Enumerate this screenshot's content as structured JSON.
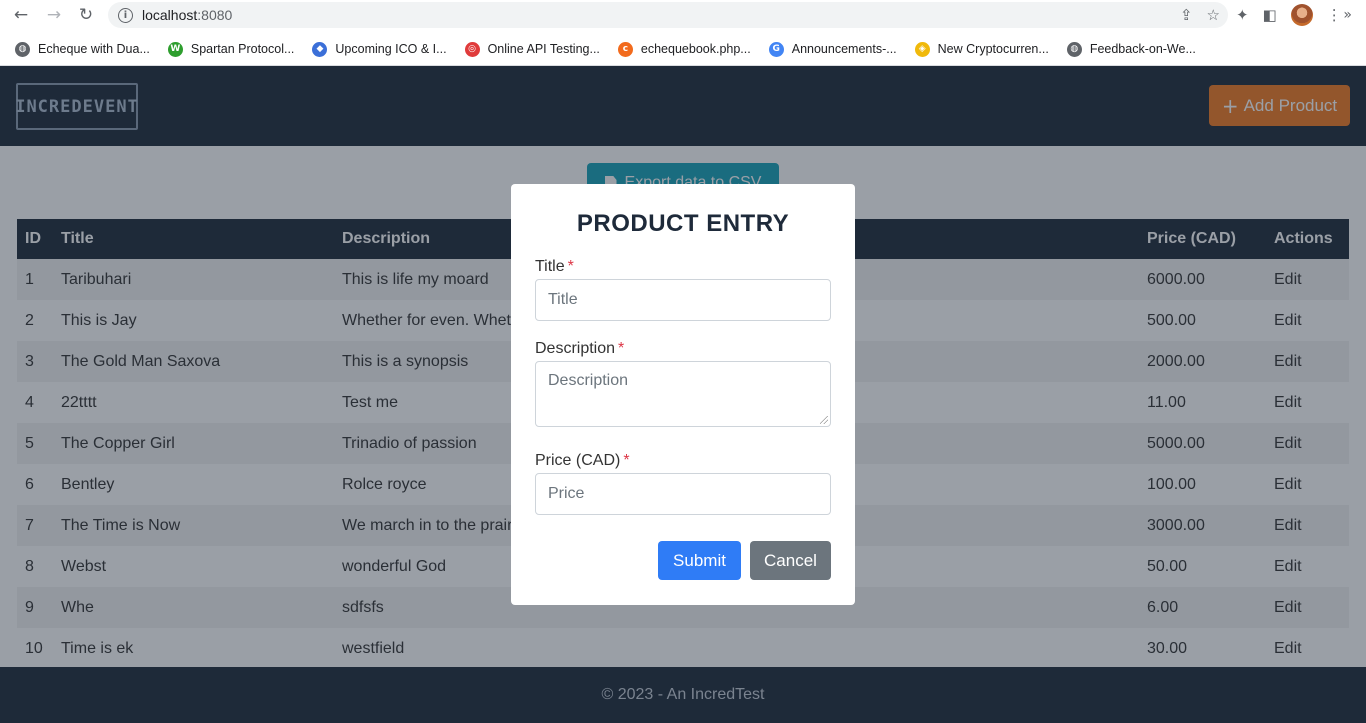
{
  "browser": {
    "url_host": "localhost",
    "url_port": ":8080",
    "bookmarks": [
      {
        "label": "Echeque with Dua...",
        "icon": "globe-icon",
        "color": "#5f6368"
      },
      {
        "label": "Spartan Protocol...",
        "icon": "spartan-icon",
        "color": "#2e9e2e"
      },
      {
        "label": "Upcoming ICO & I...",
        "icon": "drop-icon",
        "color": "#3b6fd8"
      },
      {
        "label": "Online API Testing...",
        "icon": "api-icon",
        "color": "#e03b3b"
      },
      {
        "label": "echequebook.php...",
        "icon": "cpanel-icon",
        "color": "#f26b1d"
      },
      {
        "label": "Announcements-...",
        "icon": "g-icon",
        "color": "#4285f4"
      },
      {
        "label": "New Cryptocurren...",
        "icon": "binance-icon",
        "color": "#f0b90b"
      },
      {
        "label": "Feedback-on-We...",
        "icon": "globe-icon",
        "color": "#5f6368"
      }
    ]
  },
  "app": {
    "logo_text": "INCREDEVENT",
    "add_button_label": "Add Product",
    "export_button_label": "Export data to CSV",
    "footer_text": "© 2023 - An IncredTest"
  },
  "table": {
    "headers": [
      "ID",
      "Title",
      "Description",
      "Price (CAD)",
      "Actions"
    ],
    "rows": [
      {
        "id": "1",
        "title": "Taribuhari",
        "description": "This is life my moard",
        "price": "6000.00",
        "action": "Edit"
      },
      {
        "id": "2",
        "title": "This is Jay",
        "description": "Whether for even. Wheth",
        "price": "500.00",
        "action": "Edit"
      },
      {
        "id": "3",
        "title": "The Gold Man Saxova",
        "description": "This is a synopsis",
        "price": "2000.00",
        "action": "Edit"
      },
      {
        "id": "4",
        "title": "22tttt",
        "description": "Test me",
        "price": "11.00",
        "action": "Edit"
      },
      {
        "id": "5",
        "title": "The Copper Girl",
        "description": "Trinadio of passion",
        "price": "5000.00",
        "action": "Edit"
      },
      {
        "id": "6",
        "title": "Bentley",
        "description": "Rolce royce",
        "price": "100.00",
        "action": "Edit"
      },
      {
        "id": "7",
        "title": "The Time is Now",
        "description": "We march in to the prairi",
        "price": "3000.00",
        "action": "Edit"
      },
      {
        "id": "8",
        "title": "Webst",
        "description": "wonderful God",
        "price": "50.00",
        "action": "Edit"
      },
      {
        "id": "9",
        "title": "Whe",
        "description": "sdfsfs",
        "price": "6.00",
        "action": "Edit"
      },
      {
        "id": "10",
        "title": "Time is ek",
        "description": "westfield",
        "price": "30.00",
        "action": "Edit"
      }
    ]
  },
  "modal": {
    "title": "PRODUCT ENTRY",
    "required_mark": "*",
    "fields": {
      "title": {
        "label": "Title",
        "placeholder": "Title",
        "value": ""
      },
      "description": {
        "label": "Description",
        "placeholder": "Description",
        "value": ""
      },
      "price": {
        "label": "Price (CAD)",
        "placeholder": "Price",
        "value": ""
      }
    },
    "submit_label": "Submit",
    "cancel_label": "Cancel"
  },
  "colors": {
    "header_bg": "#1e2a3a",
    "accent_orange": "#f37b22",
    "export_teal": "#17a2b8",
    "submit_blue": "#2f7cf6",
    "cancel_gray": "#6c757d",
    "required_red": "#dc3545"
  }
}
